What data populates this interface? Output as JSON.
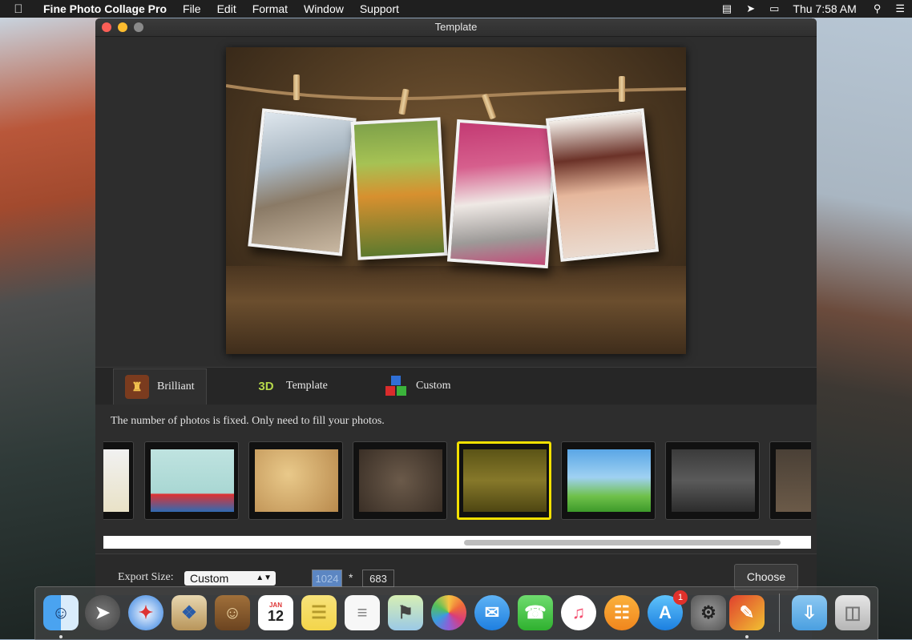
{
  "menubar": {
    "app_name": "Fine Photo Collage Pro",
    "menus": [
      "File",
      "Edit",
      "Format",
      "Window",
      "Support"
    ],
    "clock": "Thu 7:58 AM"
  },
  "window": {
    "title": "Template"
  },
  "tabs": [
    {
      "label": "Brilliant",
      "icon": "brilliant-icon",
      "active": true
    },
    {
      "label": "Template",
      "icon": "3d-icon",
      "active": false
    },
    {
      "label": "Custom",
      "icon": "cubes-icon",
      "active": false
    }
  ],
  "hint": "The number of photos is fixed. Only need to fill your photos.",
  "templates": [
    {
      "name": "template-partial",
      "selected": false
    },
    {
      "name": "template-little-house",
      "selected": false
    },
    {
      "name": "template-scrapbook",
      "selected": false
    },
    {
      "name": "template-brick-frames",
      "selected": false
    },
    {
      "name": "template-clothesline",
      "selected": true
    },
    {
      "name": "template-sky-meadow",
      "selected": false
    },
    {
      "name": "template-dark-line",
      "selected": false
    },
    {
      "name": "template-partial-right",
      "selected": false
    }
  ],
  "export": {
    "label": "Export Size:",
    "size_option": "Custom",
    "width": "1024",
    "times": "*",
    "height": "683",
    "choose_label": "Choose"
  },
  "dock": {
    "app_store_badge": "1",
    "calendar_month": "JAN",
    "calendar_day": "12"
  }
}
